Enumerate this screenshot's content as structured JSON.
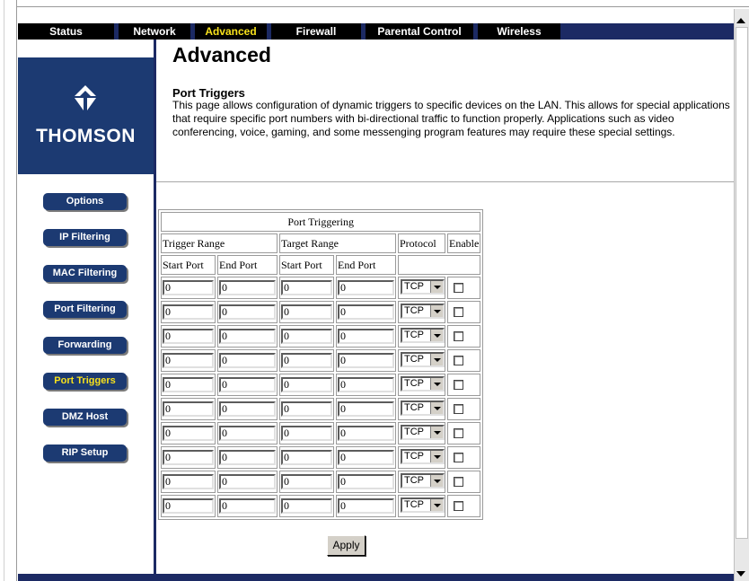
{
  "nav": {
    "items": [
      {
        "label": "Status",
        "active": false
      },
      {
        "label": "Network",
        "active": false
      },
      {
        "label": "Advanced",
        "active": true
      },
      {
        "label": "Firewall",
        "active": false
      },
      {
        "label": "Parental Control",
        "active": false
      },
      {
        "label": "Wireless",
        "active": false
      }
    ],
    "active_color": "#f7e11c"
  },
  "logo": {
    "text": "THOMSON",
    "icon": "thomson-logo-icon"
  },
  "sidebar": {
    "items": [
      {
        "label": "Options",
        "active": false
      },
      {
        "label": "IP Filtering",
        "active": false
      },
      {
        "label": "MAC Filtering",
        "active": false
      },
      {
        "label": "Port Filtering",
        "active": false
      },
      {
        "label": "Forwarding",
        "active": false
      },
      {
        "label": "Port Triggers",
        "active": true
      },
      {
        "label": "DMZ Host",
        "active": false
      },
      {
        "label": "RIP Setup",
        "active": false
      }
    ]
  },
  "main": {
    "title": "Advanced",
    "section_title": "Port Triggers",
    "description": "This page allows configuration of dynamic triggers to specific devices on the LAN. This allows for special applications that require specific port numbers with bi-directional traffic to function properly. Applications such as video conferencing, voice, gaming, and some messenging program features may require these special settings."
  },
  "table": {
    "caption": "Port Triggering",
    "group_headers": {
      "trigger": "Trigger Range",
      "target": "Target Range",
      "protocol": "Protocol",
      "enable": "Enable"
    },
    "sub_headers": {
      "start": "Start Port",
      "end": "End Port",
      "target_start": "Start Port",
      "target_end": "End Port"
    },
    "rows": [
      {
        "trigger_start": "0",
        "trigger_end": "0",
        "target_start": "0",
        "target_end": "0",
        "protocol": "TCP",
        "enabled": false
      },
      {
        "trigger_start": "0",
        "trigger_end": "0",
        "target_start": "0",
        "target_end": "0",
        "protocol": "TCP",
        "enabled": false
      },
      {
        "trigger_start": "0",
        "trigger_end": "0",
        "target_start": "0",
        "target_end": "0",
        "protocol": "TCP",
        "enabled": false
      },
      {
        "trigger_start": "0",
        "trigger_end": "0",
        "target_start": "0",
        "target_end": "0",
        "protocol": "TCP",
        "enabled": false
      },
      {
        "trigger_start": "0",
        "trigger_end": "0",
        "target_start": "0",
        "target_end": "0",
        "protocol": "TCP",
        "enabled": false
      },
      {
        "trigger_start": "0",
        "trigger_end": "0",
        "target_start": "0",
        "target_end": "0",
        "protocol": "TCP",
        "enabled": false
      },
      {
        "trigger_start": "0",
        "trigger_end": "0",
        "target_start": "0",
        "target_end": "0",
        "protocol": "TCP",
        "enabled": false
      },
      {
        "trigger_start": "0",
        "trigger_end": "0",
        "target_start": "0",
        "target_end": "0",
        "protocol": "TCP",
        "enabled": false
      },
      {
        "trigger_start": "0",
        "trigger_end": "0",
        "target_start": "0",
        "target_end": "0",
        "protocol": "TCP",
        "enabled": false
      },
      {
        "trigger_start": "0",
        "trigger_end": "0",
        "target_start": "0",
        "target_end": "0",
        "protocol": "TCP",
        "enabled": false
      }
    ]
  },
  "apply_label": "Apply",
  "colors": {
    "brand_navy": "#1c3a72",
    "nav_bar": "#1c2a64",
    "active_text": "#f7e11c"
  }
}
